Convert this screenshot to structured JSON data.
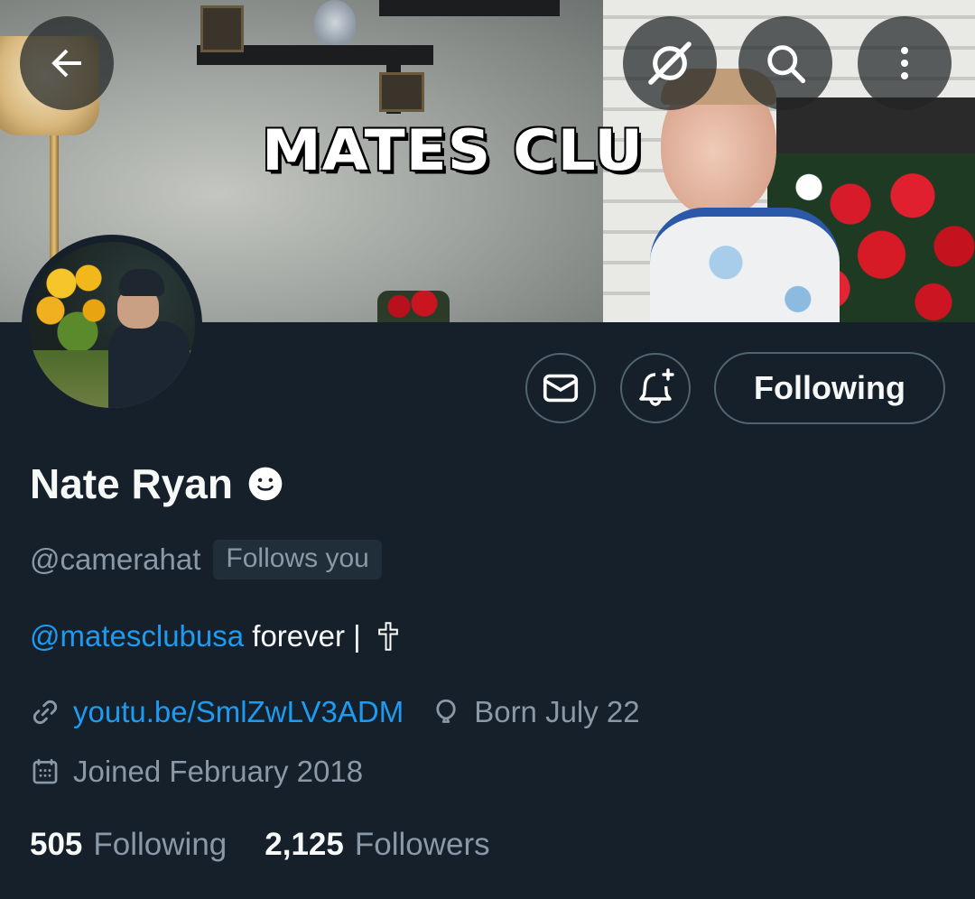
{
  "banner": {
    "text": "MATES CLU"
  },
  "header": {
    "back_icon": "arrow-left-icon",
    "grok_icon": "grok-icon",
    "search_icon": "search-icon",
    "more_icon": "more-vertical-icon"
  },
  "actions": {
    "message_icon": "envelope-icon",
    "notify_icon": "bell-plus-icon",
    "following_label": "Following"
  },
  "profile": {
    "display_name": "Nate Ryan",
    "name_emoji_icon": "smiley-icon",
    "handle": "@camerahat",
    "follows_you": "Follows you",
    "bio": {
      "mention": "@matesclubusa",
      "text": " forever | ",
      "emoji_icon": "cross-icon"
    },
    "website": "youtu.be/SmlZwLV3ADM",
    "birthday": "Born July 22",
    "joined": "Joined February 2018"
  },
  "stats": {
    "following_count": "505",
    "following_label": "Following",
    "followers_count": "2,125",
    "followers_label": "Followers"
  },
  "colors": {
    "background": "#15202b",
    "text_primary": "#f7f9f9",
    "text_secondary": "#8b98a5",
    "accent": "#1d9bf0",
    "border": "#536471"
  }
}
